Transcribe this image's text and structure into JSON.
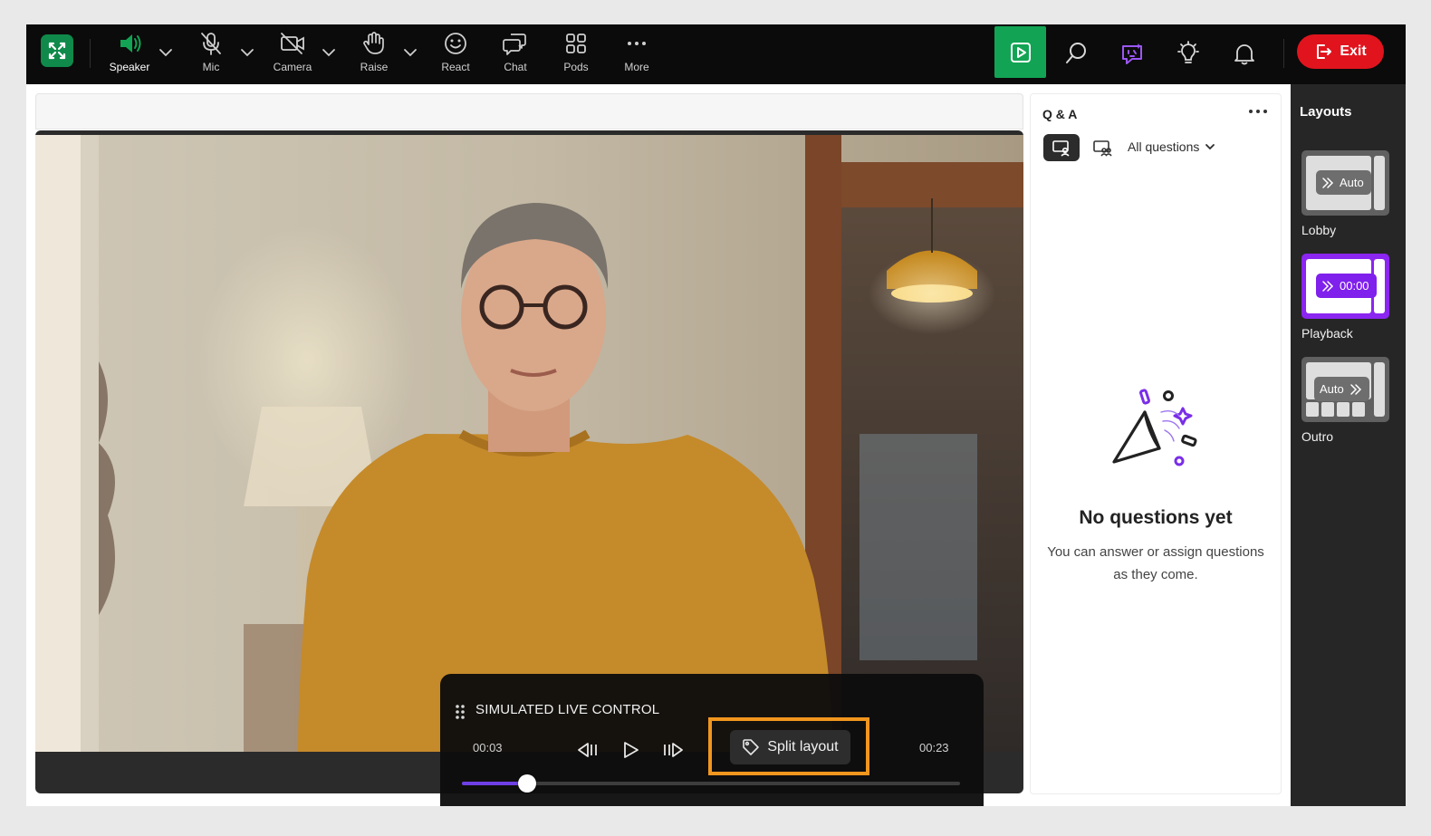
{
  "toolbar": {
    "speaker_label": "Speaker",
    "mic_label": "Mic",
    "camera_label": "Camera",
    "raise_label": "Raise",
    "react_label": "React",
    "chat_label": "Chat",
    "pods_label": "Pods",
    "more_label": "More",
    "exit_label": "Exit"
  },
  "live_control": {
    "title": "SIMULATED LIVE CONTROL",
    "current_time": "00:03",
    "total_time": "00:23",
    "split_label": "Split layout",
    "progress_fraction": 0.13
  },
  "qa": {
    "title": "Q & A",
    "filter_label": "All questions",
    "empty_title": "No questions yet",
    "empty_desc": "You can answer or assign questions as they come."
  },
  "layouts": {
    "title": "Layouts",
    "items": [
      {
        "name": "Lobby",
        "pill": "Auto",
        "active": false
      },
      {
        "name": "Playback",
        "pill": "00:00",
        "active": true
      },
      {
        "name": "Outro",
        "pill": "Auto",
        "active": false
      }
    ]
  },
  "colors": {
    "accent_green": "#12a454",
    "exit_red": "#e1141e",
    "highlight_orange": "#f1961e",
    "active_purple": "#8b25f0",
    "progress_purple": "#6f3fe6"
  }
}
